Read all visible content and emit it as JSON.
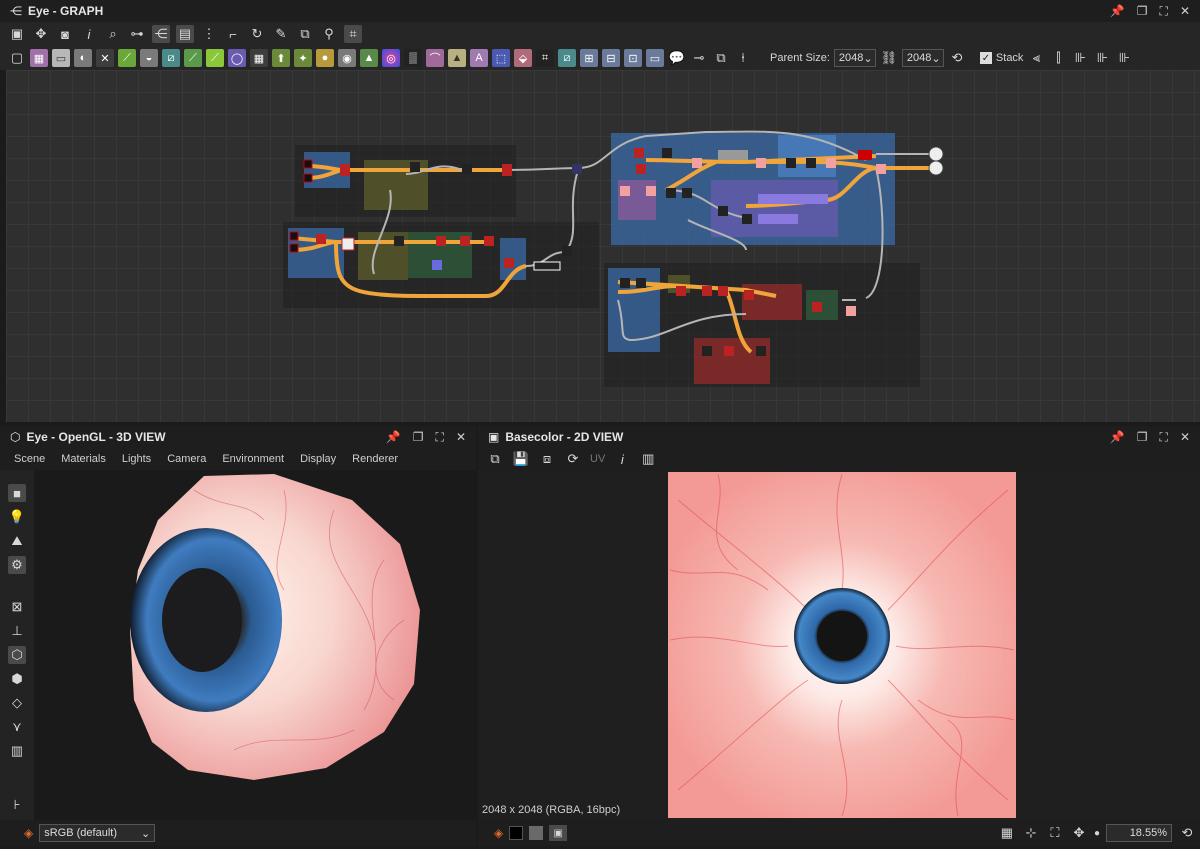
{
  "graph": {
    "title": "Eye - GRAPH",
    "parent_size_label": "Parent Size:",
    "parent_size_value": "2048",
    "output_size_value": "2048",
    "stack_label": "Stack"
  },
  "view3d": {
    "title": "Eye - OpenGL - 3D VIEW",
    "menu": [
      "Scene",
      "Materials",
      "Lights",
      "Camera",
      "Environment",
      "Display",
      "Renderer"
    ],
    "colorspace": "sRGB (default)"
  },
  "view2d": {
    "title": "Basecolor - 2D VIEW",
    "uv_label": "UV",
    "image_info": "2048 x 2048 (RGBA, 16bpc)",
    "zoom": "18.55%"
  },
  "colors": {
    "accent_orange": "#f0a53a",
    "wire_gray": "#b5b5b5",
    "frame_blue": "#3a6fb0",
    "frame_purple": "#6a5ab0",
    "frame_red": "#8a2a2a",
    "frame_olive": "#5a5a2a"
  }
}
